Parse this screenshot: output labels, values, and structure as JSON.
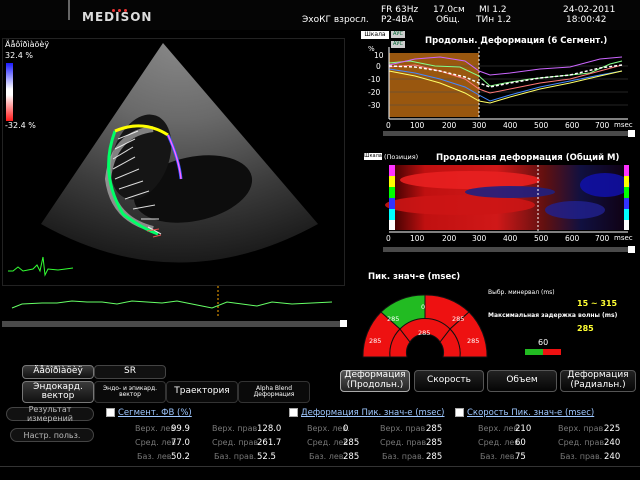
{
  "header": {
    "brand": "MEDISON",
    "preset": "ЭхоКГ взросл.",
    "fr": "FR 63Hz",
    "depth": "17.0см",
    "mi": "MI  1.2",
    "date": "24-02-2011",
    "probe": "P2-4BA",
    "gen": "Общ.",
    "tis": "TИн 1.2",
    "time": "18:00:42"
  },
  "image": {
    "label": "Äåôîðìàöèÿ",
    "max": "32.4 %",
    "min": "-32.4 %"
  },
  "graph1": {
    "scale_btn": "Шкала",
    "tag1": "АУС",
    "tag2": "АУС",
    "title": "Продольн. Деформация (6 Сегмент.)",
    "unit_y": "%",
    "yticks": [
      "10",
      "0",
      "-10",
      "-20",
      "-30"
    ],
    "xticks": [
      "0",
      "100",
      "200",
      "300",
      "400",
      "500",
      "600",
      "700"
    ],
    "xunit": "msec"
  },
  "graph2": {
    "scale_btn": "Шкала",
    "sub": "(Позиция)",
    "title": "Продольная деформация (Общий М)",
    "xticks": [
      "0",
      "100",
      "200",
      "300",
      "400",
      "500",
      "600",
      "700"
    ],
    "xunit": "msec"
  },
  "bullseye": {
    "title": "Пик. знач-е (msec)",
    "segments": [
      "285",
      "285",
      "0",
      "285",
      "285",
      "285"
    ],
    "colors": {
      "red": "#ee1111",
      "green": "#22bb22"
    },
    "sel_label": "Выбр. минервал (ms)",
    "sel_value": "15 ~ 315",
    "delay_label": "Максимальная задержка волны (ms)",
    "delay_value": "285",
    "scale_value": "60"
  },
  "tabs": {
    "deformation": "Äåôîðìàöèÿ",
    "sr": "SR",
    "endo_vector": "Эндокард. вектор",
    "endo_epi": "Эндо- и эпикард. вектор",
    "trajectory": "Траектория",
    "alpha_blend": "Alpha Blend Деформация"
  },
  "modes": {
    "long": "Деформация (Продольн.)",
    "speed": "Скорость",
    "volume": "Объем",
    "radial": "Деформация (Радиальн.)"
  },
  "side": {
    "result": "Результат измерений",
    "settings": "Настр. польз."
  },
  "tables": [
    {
      "title": "Сегмент. ФВ (%)",
      "left": [
        {
          "label": "Верх. лев.",
          "value": "99.9"
        },
        {
          "label": "Сред. лев.",
          "value": "77.0"
        },
        {
          "label": "Баз. лев.",
          "value": "50.2"
        }
      ],
      "right": [
        {
          "label": "Верх. прав.",
          "value": "128.0"
        },
        {
          "label": "Сред. прав.",
          "value": "261.7"
        },
        {
          "label": "Баз. прав.",
          "value": "52.5"
        }
      ]
    },
    {
      "title": "Деформация Пик. знач-е (msec)",
      "left": [
        {
          "label": "Верх. лев.",
          "value": "0"
        },
        {
          "label": "Сред. лев.",
          "value": "285"
        },
        {
          "label": "Баз. лев.",
          "value": "285"
        }
      ],
      "right": [
        {
          "label": "Верх. прав.",
          "value": "285"
        },
        {
          "label": "Сред. прав.",
          "value": "285"
        },
        {
          "label": "Баз. прав.",
          "value": "285"
        }
      ]
    },
    {
      "title": "Скорость Пик. знач-е (msec)",
      "left": [
        {
          "label": "Верх. лев.",
          "value": "210"
        },
        {
          "label": "Сред. лев.",
          "value": "60"
        },
        {
          "label": "Баз. лев.",
          "value": "75"
        }
      ],
      "right": [
        {
          "label": "Верх. прав.",
          "value": "225"
        },
        {
          "label": "Сред. прав.",
          "value": "240"
        },
        {
          "label": "Баз. прав.",
          "value": "240"
        }
      ]
    }
  ]
}
